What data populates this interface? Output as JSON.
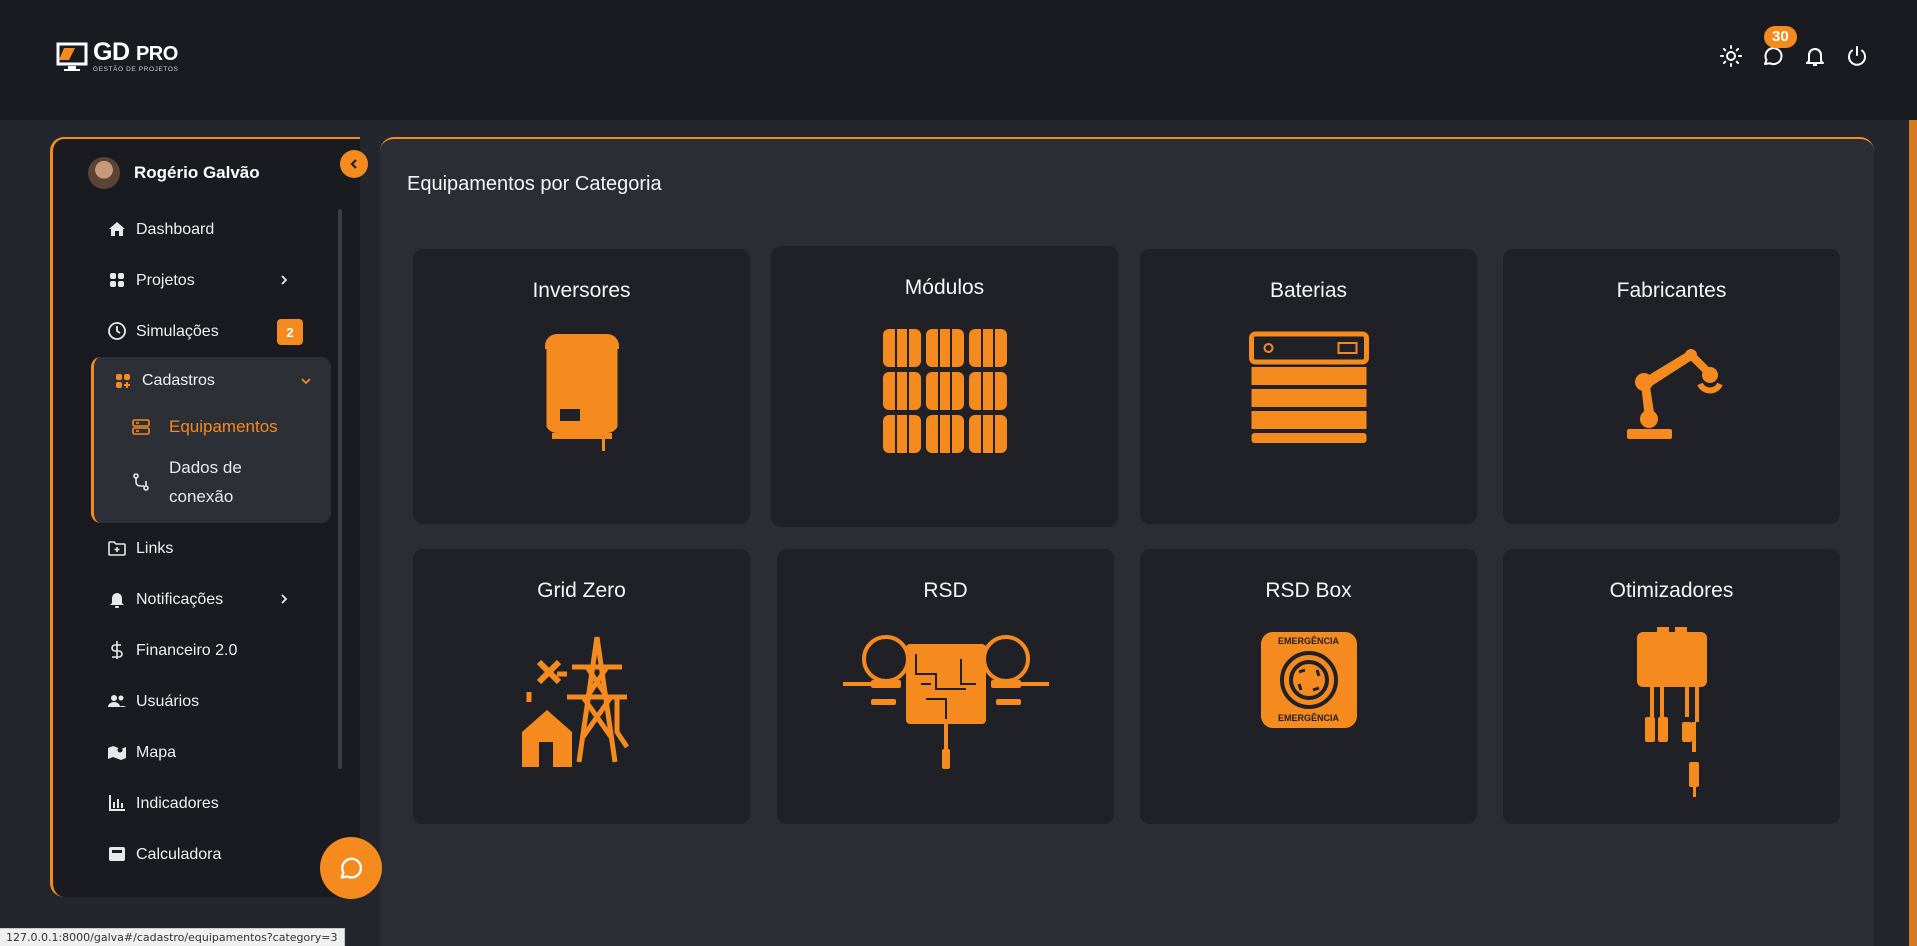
{
  "app": {
    "logo_main": "GD",
    "logo_pro": "PRO",
    "logo_sub": "GESTÃO DE PROJETOS",
    "accent": "#f58a1f"
  },
  "header": {
    "icons": [
      "sun-icon",
      "chat-icon",
      "bell-icon",
      "power-icon"
    ],
    "messages_badge": "30"
  },
  "sidebar": {
    "user_name": "Rogério Galvão",
    "items": [
      {
        "label": "Dashboard",
        "icon": "home-icon"
      },
      {
        "label": "Projetos",
        "icon": "grid-icon"
      },
      {
        "label": "Simulações",
        "icon": "clock-icon",
        "badge": "2"
      },
      {
        "label": "Links",
        "icon": "folder-plus-icon"
      },
      {
        "label": "Notificações",
        "icon": "bell-icon"
      },
      {
        "label": "Financeiro 2.0",
        "icon": "dollar-icon"
      },
      {
        "label": "Usuários",
        "icon": "users-icon"
      },
      {
        "label": "Mapa",
        "icon": "map-icon"
      },
      {
        "label": "Indicadores",
        "icon": "bar-chart-icon"
      },
      {
        "label": "Calculadora",
        "icon": "calculator-icon"
      }
    ],
    "group": {
      "label": "Cadastros",
      "icon": "apps-icon",
      "children": [
        {
          "label": "Equipamentos",
          "icon": "server-icon",
          "active": true
        },
        {
          "label": "Dados de conexão",
          "icon": "git-icon"
        }
      ]
    }
  },
  "main": {
    "title": "Equipamentos por Categoria",
    "categories": [
      {
        "label": "Inversores",
        "icon": "inverter-icon"
      },
      {
        "label": "Módulos",
        "icon": "solar-panel-icon"
      },
      {
        "label": "Baterias",
        "icon": "battery-icon"
      },
      {
        "label": "Fabricantes",
        "icon": "robot-arm-icon"
      },
      {
        "label": "Grid Zero",
        "icon": "power-tower-icon"
      },
      {
        "label": "RSD",
        "icon": "rsd-icon"
      },
      {
        "label": "RSD Box",
        "icon": "emergency-box-icon",
        "box_text": "EMERGÊNCIA"
      },
      {
        "label": "Otimizadores",
        "icon": "optimizer-icon"
      }
    ]
  },
  "statusbar": {
    "url": "127.0.0.1:8000/galva#/cadastro/equipamentos?category=3"
  }
}
